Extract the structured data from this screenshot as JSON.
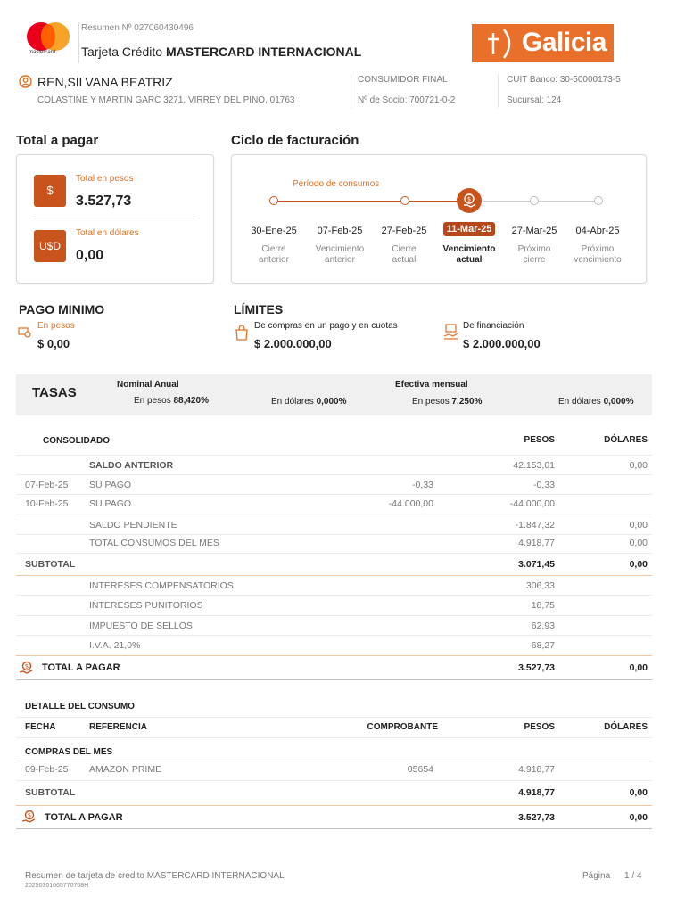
{
  "header": {
    "mastercard_logo_text": "mastercard",
    "resumen": "Resumen Nº 027060430496",
    "tarjeta_prefix": "Tarjeta Crédito",
    "tarjeta_name": "MASTERCARD INTERNACIONAL",
    "bank_logo_text": "Galicia"
  },
  "client": {
    "name": "REN,SILVANA BEATRIZ",
    "address": "COLASTINE Y MARTIN GARC 3271, VIRREY DEL PINO, 01763",
    "category": "CONSUMIDOR FINAL",
    "socio": "Nº de Socio: 700721-0-2",
    "cuit": "CUIT Banco: 30-50000173-5",
    "sucursal": "Sucursal: 124"
  },
  "total_a_pagar": {
    "title": "Total a pagar",
    "pesos_icon": "$",
    "pesos_label": "Total en pesos",
    "pesos_value": "3.527,73",
    "dolares_icon": "U$D",
    "dolares_label": "Total en dólares",
    "dolares_value": "0,00"
  },
  "ciclo": {
    "title": "Ciclo de facturación",
    "periodo_label": "Período de consumos",
    "items": [
      {
        "date": "30-Ene-25",
        "l1": "Cierre",
        "l2": "anterior"
      },
      {
        "date": "07-Feb-25",
        "l1": "Vencimiento",
        "l2": "anterior"
      },
      {
        "date": "27-Feb-25",
        "l1": "Cierre",
        "l2": "actual"
      },
      {
        "date": "11-Mar-25",
        "l1": "Vencimiento",
        "l2": "actual"
      },
      {
        "date": "27-Mar-25",
        "l1": "Próximo",
        "l2": "cierre"
      },
      {
        "date": "04-Abr-25",
        "l1": "Próximo",
        "l2": "vencimiento"
      }
    ]
  },
  "pago_minimo": {
    "title": "PAGO MINIMO",
    "label": "En pesos",
    "value": "$ 0,00"
  },
  "limites": {
    "title": "LÍMITES",
    "compras_label": "De compras en un pago y en cuotas",
    "compras_value": "$ 2.000.000,00",
    "financiacion_label": "De financiación",
    "financiacion_value": "$ 2.000.000,00"
  },
  "tasas": {
    "title": "TASAS",
    "nominal_label": "Nominal Anual",
    "efectiva_label": "Efectiva mensual",
    "en_pesos": "En pesos",
    "en_dolares": "En dólares",
    "nominal_pesos": "88,420%",
    "nominal_dolares": "0,000%",
    "efectiva_pesos": "7,250%",
    "efectiva_dolares": "0,000%"
  },
  "consolidado": {
    "title": "CONSOLIDADO",
    "col_pesos": "PESOS",
    "col_dolares": "DÓLARES",
    "rows": [
      {
        "fecha": "",
        "desc": "SALDO ANTERIOR",
        "mid": "",
        "pesos": "42.153,01",
        "dolares": "0,00"
      },
      {
        "fecha": "07-Feb-25",
        "desc": "SU PAGO",
        "mid": "-0,33",
        "pesos": "-0,33",
        "dolares": ""
      },
      {
        "fecha": "10-Feb-25",
        "desc": "SU PAGO",
        "mid": "-44.000,00",
        "pesos": "-44.000,00",
        "dolares": ""
      },
      {
        "fecha": "",
        "desc": "SALDO PENDIENTE",
        "mid": "",
        "pesos": "-1.847,32",
        "dolares": "0,00"
      },
      {
        "fecha": "",
        "desc": "TOTAL CONSUMOS DEL MES",
        "mid": "",
        "pesos": "4.918,77",
        "dolares": "0,00"
      }
    ],
    "subtotal_label": "SUBTOTAL",
    "subtotal_pesos": "3.071,45",
    "subtotal_dolares": "0,00",
    "extras": [
      {
        "desc": "INTERESES COMPENSATORIOS",
        "pesos": "306,33"
      },
      {
        "desc": "INTERESES PUNITORIOS",
        "pesos": "18,75"
      },
      {
        "desc": "IMPUESTO DE SELLOS",
        "pesos": "62,93"
      },
      {
        "desc": "I.V.A. 21,0%",
        "pesos": "68,27"
      }
    ],
    "total_label": "TOTAL A PAGAR",
    "total_pesos": "3.527,73",
    "total_dolares": "0,00"
  },
  "detalle": {
    "title": "DETALLE DEL CONSUMO",
    "col_fecha": "FECHA",
    "col_referencia": "REFERENCIA",
    "col_comprobante": "COMPROBANTE",
    "col_pesos": "PESOS",
    "col_dolares": "DÓLARES",
    "group": "COMPRAS DEL MES",
    "rows": [
      {
        "fecha": "09-Feb-25",
        "ref": "AMAZON PRIME",
        "comprobante": "05654",
        "pesos": "4.918,77",
        "dolares": ""
      }
    ],
    "subtotal_label": "SUBTOTAL",
    "subtotal_pesos": "4.918,77",
    "subtotal_dolares": "0,00",
    "total_label": "TOTAL A PAGAR",
    "total_pesos": "3.527,73",
    "total_dolares": "0,00"
  },
  "footer": {
    "text": "Resumen de tarjeta de credito MASTERCARD INTERNACIONAL",
    "code": "20250301065770708H",
    "page_label": "Página",
    "page_value": "1 / 4"
  },
  "colors": {
    "accent": "#c9531c",
    "brand": "#e8702a"
  }
}
